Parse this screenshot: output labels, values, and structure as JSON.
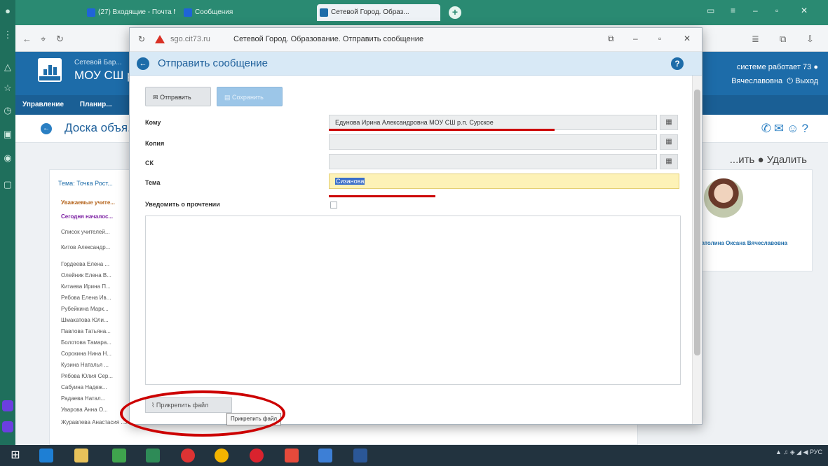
{
  "browser": {
    "tabs": [
      {
        "label": "(27) Входящие - Почта М..."
      },
      {
        "label": "Сообщения"
      },
      {
        "label": "Сетевой Город. Образ..."
      }
    ]
  },
  "background_page": {
    "school_prefix": "Сетевой Бар...",
    "school_name": "МОУ СШ р",
    "nav_items": [
      "Управление",
      "Планир..."
    ],
    "user_line1": "системе работает 73",
    "user_line2": "Вячеславовна",
    "logout": "Выход",
    "board_title": "Доска объя...",
    "actions": "...ить ● Удалить",
    "theme": "Тема: Точка Рост...",
    "rows": [
      "Уважаемые учите...",
      "Сегодня началос...",
      "Список учителей...",
      "Китов Александр...",
      "Гордеева Елена ...",
      "Олейник Елена В...",
      "Китаева Ирина П...",
      "Рябова Елена Ив...",
      "Рубейкина Марк...",
      "Шмакатова Юли...",
      "Павлова Татьяна...",
      "Болотова Тамара...",
      "Сорокина Нина Н...",
      "Кузина Наталья ...",
      "Рябова Юлия Сер...",
      "Сабуина Надеж...",
      "Радаева Натал...",
      "Уварова Анна О...",
      "Журавлева Анастасия ...лаевна"
    ],
    "profile_name": "...атолина Оксана Вячеславовна"
  },
  "popup": {
    "url": "sgo.cit73.ru",
    "window_title": "Сетевой Город. Образование. Отправить сообщение",
    "header_title": "Отправить сообщение",
    "send_label": "Отправить",
    "save_label": "Сохранить",
    "to_label": "Кому",
    "to_value": "Едунова Ирина Александровна МОУ СШ р.п. Сурское",
    "copy_label": "Копия",
    "bcc_label": "СК",
    "subject_label": "Тема",
    "subject_value": "Сизанова",
    "notify_label": "Уведомить о прочтении",
    "attach_label": "Прикрепить файл",
    "tooltip": "Прикрепить файл"
  },
  "colors": {
    "accent": "#1d6ca9",
    "annotation": "#c00000"
  }
}
